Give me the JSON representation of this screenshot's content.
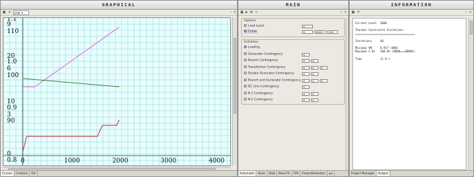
{
  "graphical": {
    "title": "GRAPHICAL",
    "plot_selector": "pspr ▾",
    "yticks": [
      "1.1",
      "9",
      "110",
      "20",
      "1.0",
      "6",
      "100",
      "10",
      "0.9",
      "3",
      "90",
      "0",
      "0.8"
    ],
    "xticks": [
      "0",
      "1000",
      "2000",
      "3000",
      "4000"
    ],
    "tabs": [
      "Curves",
      "Creation",
      "OH"
    ],
    "colors": {
      "magenta": "#e060e0",
      "green": "#2f8a3a",
      "red": "#c8283a",
      "grid": "#7fd6d6",
      "plot_bg": "#eafdfd"
    },
    "chart_data": {
      "type": "line",
      "xlim": [
        0,
        4300
      ],
      "grid": true,
      "series": [
        {
          "color": "#e060e0",
          "x": [
            0,
            250,
            2000
          ],
          "y": [
            0.95,
            0.95,
            1.08
          ],
          "ylim": [
            0.8,
            1.1
          ]
        },
        {
          "color": "#2f8a3a",
          "x": [
            0,
            2000
          ],
          "y": [
            108,
            105
          ],
          "ylim": [
            80,
            130
          ]
        },
        {
          "color": "#c8283a",
          "x": [
            0,
            80,
            300,
            1550,
            1650,
            1950,
            2000
          ],
          "y": [
            0.3,
            1.4,
            1.4,
            1.4,
            2.2,
            2.2,
            2.6
          ],
          "ylim": [
            0,
            10
          ]
        }
      ]
    }
  },
  "main": {
    "title": "MAIN",
    "options_label": "Options",
    "load_level_label": "Load Level",
    "load_level_value": "0",
    "curve_label": "Curve",
    "curve_values": [
      "0",
      "4000",
      "100"
    ],
    "activities_label": "Activities",
    "activities": [
      {
        "label": "Loading",
        "fields": []
      },
      {
        "label": "Generator Contingency",
        "fields": [
          "0"
        ]
      },
      {
        "label": "Branch Contingency",
        "fields": [
          "0",
          "0"
        ]
      },
      {
        "label": "Transformer Contingency",
        "fields": [
          "0",
          "0",
          "0"
        ]
      },
      {
        "label": "Double Generator Contingency",
        "fields": [
          "0",
          "0"
        ]
      },
      {
        "label": "Branch and Generator Contingency",
        "fields": [
          "0",
          "0",
          "0"
        ]
      },
      {
        "label": "DC Line Contingency",
        "fields": [
          "0"
        ]
      },
      {
        "label": "N-1 Contingency",
        "fields": [
          "0",
          "0"
        ]
      },
      {
        "label": "N-2 Contingency",
        "fields": [
          "0",
          "0"
        ]
      }
    ],
    "tabs": [
      "Automatic",
      "Basic",
      "Blsk",
      "BasicTS",
      "FPS",
      "ProjectSelection"
    ]
  },
  "information": {
    "title": "INFORMATION",
    "lines": [
      "Current Level  2000",
      "Thermal Constraint Violations",
      "====================================",
      "Iterations     40",
      "Minimum VN     0.957 (000)",
      "Maximum S Bc   100.9% (0000===0000%)",
      "Time           11.9 s"
    ],
    "tabs": [
      "Project Manager",
      "Output"
    ]
  }
}
